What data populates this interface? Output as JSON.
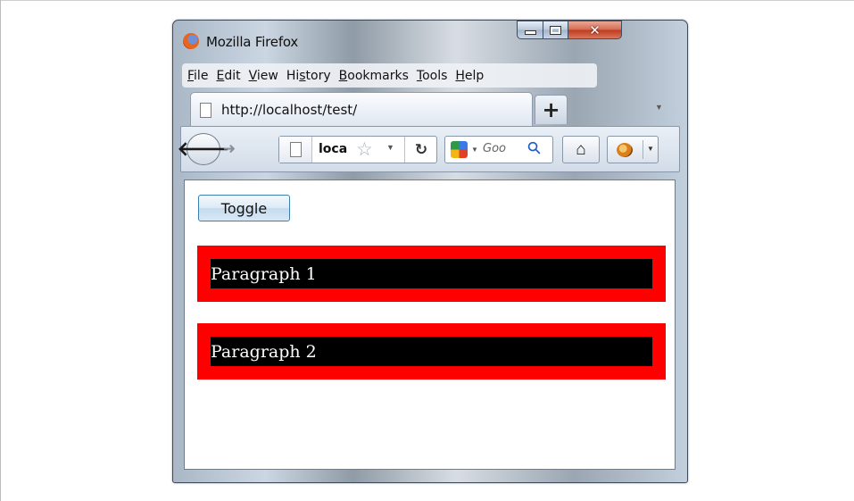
{
  "window": {
    "title": "Mozilla Firefox"
  },
  "menubar": {
    "items": [
      {
        "pre": "",
        "u": "F",
        "post": "ile"
      },
      {
        "pre": "",
        "u": "E",
        "post": "dit"
      },
      {
        "pre": "",
        "u": "V",
        "post": "iew"
      },
      {
        "pre": "Hi",
        "u": "s",
        "post": "tory"
      },
      {
        "pre": "",
        "u": "B",
        "post": "ookmarks"
      },
      {
        "pre": "",
        "u": "T",
        "post": "ools"
      },
      {
        "pre": "",
        "u": "H",
        "post": "elp"
      }
    ]
  },
  "tab": {
    "label": "http://localhost/test/",
    "new_tab_label": "+"
  },
  "navbar": {
    "url_text": "loca",
    "search_placeholder": "Goo"
  },
  "icons": {
    "back": "back-arrow-icon",
    "forward": "forward-arrow-icon",
    "reload": "reload-icon",
    "bookmark": "star-icon",
    "home": "home-icon",
    "search_engine": "google-icon",
    "addon": "ladybug-icon"
  },
  "content": {
    "toggle_label": "Toggle",
    "paragraphs": [
      "Paragraph 1",
      "Paragraph 2"
    ]
  },
  "colors": {
    "paragraph_border": "#ff0000",
    "paragraph_background": "#000000",
    "paragraph_text": "#ffffff"
  }
}
